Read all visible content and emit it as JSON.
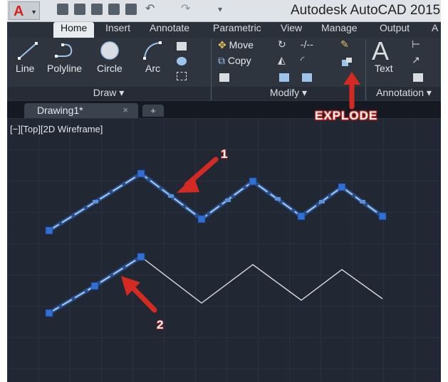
{
  "window": {
    "title": "Autodesk AutoCAD 2015"
  },
  "ribbon_tabs": [
    "Home",
    "Insert",
    "Annotate",
    "Parametric",
    "View",
    "Manage",
    "Output",
    "A"
  ],
  "draw_panel": {
    "title": "Draw",
    "tools": [
      "Line",
      "Polyline",
      "Circle",
      "Arc"
    ]
  },
  "modify_panel": {
    "title": "Modify",
    "move": "Move",
    "copy": "Copy"
  },
  "annotation_panel": {
    "title": "Annotation",
    "text": "Text"
  },
  "document": {
    "tab_name": "Drawing1*",
    "close_glyph": "×",
    "new_tab_glyph": "+"
  },
  "viewport": {
    "controls_label": "[−][Top][2D Wireframe]"
  },
  "callouts": {
    "explode": "EXPLODE",
    "marker1": "1",
    "marker2": "2"
  },
  "colors": {
    "accent_red": "#d42a22",
    "selection_blue": "#4a8fe0",
    "grip_blue": "#2f6fd6",
    "line_white": "#d9dde2"
  },
  "polylines": {
    "top_selected": true,
    "bottom_first_segments_selected": 2
  }
}
